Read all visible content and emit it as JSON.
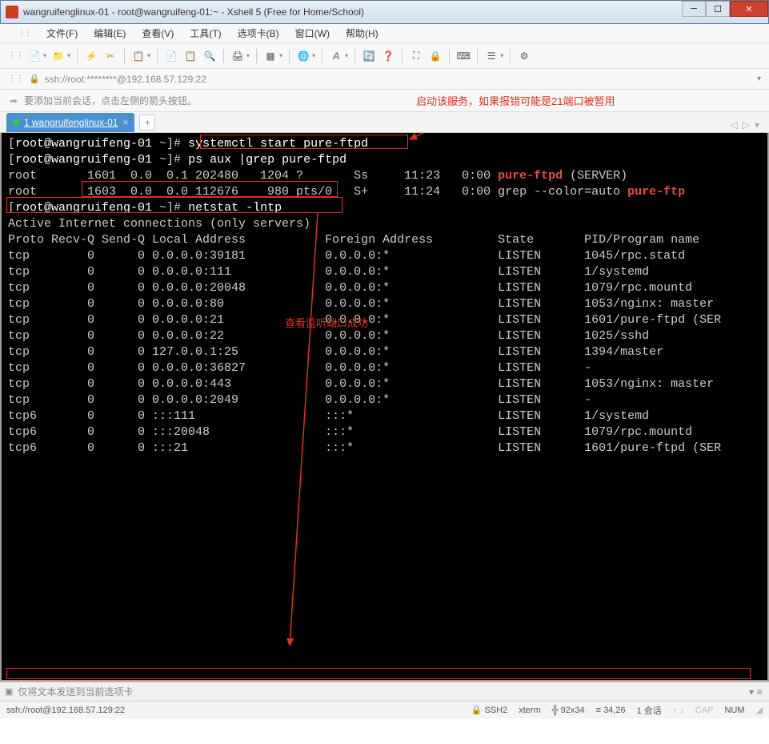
{
  "window": {
    "title": "wangruifenglinux-01 - root@wangruifeng-01:~ - Xshell 5 (Free for Home/School)"
  },
  "menu": {
    "items": [
      "文件(F)",
      "编辑(E)",
      "查看(V)",
      "工具(T)",
      "选项卡(B)",
      "窗口(W)",
      "帮助(H)"
    ]
  },
  "addressbar": {
    "text": "ssh://root:********@192.168.57.129:22"
  },
  "hint": {
    "text": "要添加当前会话，点击左侧的箭头按钮。"
  },
  "annotations": {
    "a1": "启动该服务，如果报错可能是21端口被暂用",
    "a2": "查看监听端口成功"
  },
  "tab": {
    "label": "1 wangruifenglinux-01"
  },
  "terminal": {
    "prompt_user": "root@wangruifeng-01",
    "prompt_tilde": "~",
    "cmd1": "systemctl start pure-ftpd",
    "cmd2": "ps aux |grep pure-ftpd",
    "cmd3": "netstat -lntp",
    "ps_header_none": "",
    "ps_rows": [
      {
        "user": "root",
        "pid": "1601",
        "cpu": "0.0",
        "mem": "0.1",
        "vsz": "202480",
        "rss": "1204",
        "tty": "?",
        "stat": "Ss",
        "start": "11:23",
        "time": "0:00",
        "cmd_pre": "",
        "cmd_hi": "pure-ftpd",
        "cmd_post": " (SERVER)"
      },
      {
        "user": "root",
        "pid": "1603",
        "cpu": "0.0",
        "mem": "0.0",
        "vsz": "112676",
        "rss": "980",
        "tty": "pts/0",
        "stat": "S+",
        "start": "11:24",
        "time": "0:00",
        "cmd_pre": "grep --color=auto ",
        "cmd_hi": "pure-ftp",
        "cmd_post": ""
      }
    ],
    "net_header1": "Active Internet connections (only servers)",
    "net_cols": "Proto Recv-Q Send-Q Local Address           Foreign Address         State       PID/Program name    ",
    "net_rows": [
      {
        "proto": "tcp",
        "rq": "0",
        "sq": "0",
        "local": "0.0.0.0:39181",
        "foreign": "0.0.0.0:*",
        "state": "LISTEN",
        "prog": "1045/rpc.statd      "
      },
      {
        "proto": "tcp",
        "rq": "0",
        "sq": "0",
        "local": "0.0.0.0:111",
        "foreign": "0.0.0.0:*",
        "state": "LISTEN",
        "prog": "1/systemd           "
      },
      {
        "proto": "tcp",
        "rq": "0",
        "sq": "0",
        "local": "0.0.0.0:20048",
        "foreign": "0.0.0.0:*",
        "state": "LISTEN",
        "prog": "1079/rpc.mountd     "
      },
      {
        "proto": "tcp",
        "rq": "0",
        "sq": "0",
        "local": "0.0.0.0:80",
        "foreign": "0.0.0.0:*",
        "state": "LISTEN",
        "prog": "1053/nginx: master  "
      },
      {
        "proto": "tcp",
        "rq": "0",
        "sq": "0",
        "local": "0.0.0.0:21",
        "foreign": "0.0.0.0:*",
        "state": "LISTEN",
        "prog": "1601/pure-ftpd (SER "
      },
      {
        "proto": "tcp",
        "rq": "0",
        "sq": "0",
        "local": "0.0.0.0:22",
        "foreign": "0.0.0.0:*",
        "state": "LISTEN",
        "prog": "1025/sshd           "
      },
      {
        "proto": "tcp",
        "rq": "0",
        "sq": "0",
        "local": "127.0.0.1:25",
        "foreign": "0.0.0.0:*",
        "state": "LISTEN",
        "prog": "1394/master         "
      },
      {
        "proto": "tcp",
        "rq": "0",
        "sq": "0",
        "local": "0.0.0.0:36827",
        "foreign": "0.0.0.0:*",
        "state": "LISTEN",
        "prog": "-                   "
      },
      {
        "proto": "tcp",
        "rq": "0",
        "sq": "0",
        "local": "0.0.0.0:443",
        "foreign": "0.0.0.0:*",
        "state": "LISTEN",
        "prog": "1053/nginx: master  "
      },
      {
        "proto": "tcp",
        "rq": "0",
        "sq": "0",
        "local": "0.0.0.0:2049",
        "foreign": "0.0.0.0:*",
        "state": "LISTEN",
        "prog": "-                   "
      },
      {
        "proto": "tcp6",
        "rq": "0",
        "sq": "0",
        "local": ":::111",
        "foreign": ":::*",
        "state": "LISTEN",
        "prog": "1/systemd           "
      },
      {
        "proto": "tcp6",
        "rq": "0",
        "sq": "0",
        "local": ":::20048",
        "foreign": ":::*",
        "state": "LISTEN",
        "prog": "1079/rpc.mountd     "
      },
      {
        "proto": "tcp6",
        "rq": "0",
        "sq": "0",
        "local": ":::21",
        "foreign": ":::*",
        "state": "LISTEN",
        "prog": "1601/pure-ftpd (SER "
      }
    ]
  },
  "inputbar": {
    "text": "仅将文本发送到当前选项卡"
  },
  "status": {
    "left": "ssh://root@192.168.57.129:22",
    "ssh": "SSH2",
    "term": "xterm",
    "size": "92x34",
    "pos": "34,26",
    "sessions": "1 会话",
    "cap": "CAP",
    "num": "NUM"
  }
}
